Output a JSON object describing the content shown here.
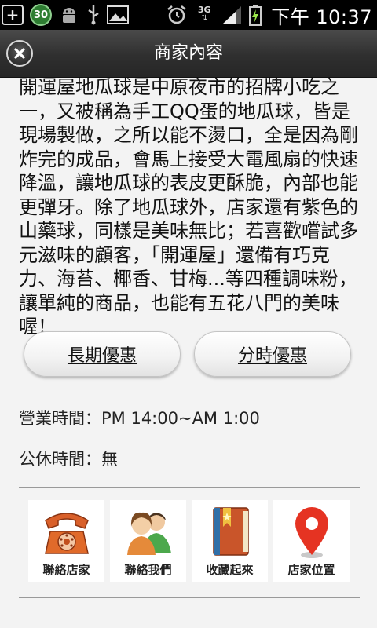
{
  "status_bar": {
    "badge": "30",
    "network": "3G",
    "time": "下午 10:37"
  },
  "header": {
    "title": "商家內容"
  },
  "content": {
    "description": "開運屋地瓜球是中原夜市的招牌小吃之一，又被稱為手工QQ蛋的地瓜球，皆是現場製做，之所以能不燙口，全是因為剛炸完的成品，會馬上接受大電風扇的快速降溫，讓地瓜球的表皮更酥脆，內部也能更彈牙。除了地瓜球外，店家還有紫色的山藥球，同樣是美味無比；若喜歡嚐試多元滋味的顧客，「開運屋」還備有巧克力、海苔、椰香、甘梅...等四種調味粉，讓單純的商品，也能有五花八門的美味喔！",
    "offers": {
      "long_term": "長期優惠",
      "timed": "分時優惠"
    },
    "business_hours": "營業時間：PM 14:00~AM 1:00",
    "closed_days": "公休時間：無"
  },
  "actions": [
    {
      "label": "聯絡店家",
      "icon": "telephone-icon"
    },
    {
      "label": "聯絡我們",
      "icon": "people-icon"
    },
    {
      "label": "收藏起來",
      "icon": "bookmark-book-icon"
    },
    {
      "label": "店家位置",
      "icon": "map-pin-icon"
    }
  ],
  "colors": {
    "status_bar": "#000000",
    "title_bar": "#2f2f2f",
    "page_bg": "#f3f3f3",
    "pin_red": "#e53322",
    "book_orange": "#d35a2a",
    "phone_orange": "#e06a2a"
  }
}
